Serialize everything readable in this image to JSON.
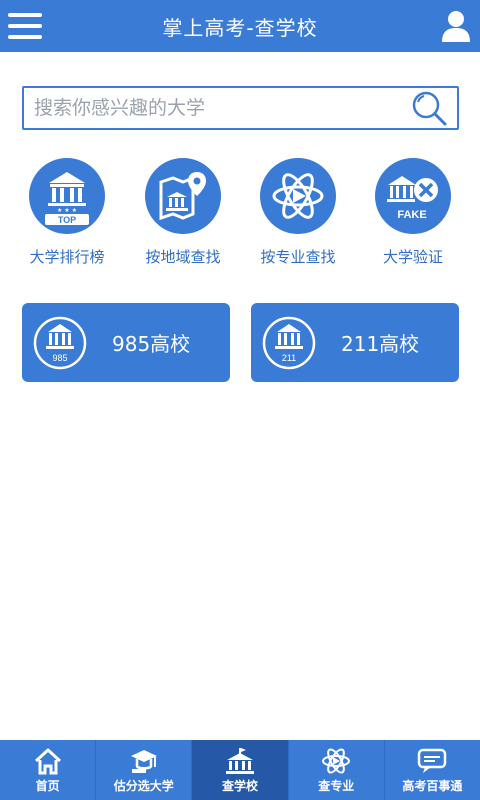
{
  "header": {
    "title": "掌上高考-查学校"
  },
  "search": {
    "placeholder": "搜索你感兴趣的大学"
  },
  "quick": [
    {
      "label": "大学排行榜",
      "icon": "ranking-top-icon",
      "badge": "TOP"
    },
    {
      "label": "按地域查找",
      "icon": "map-pin-icon"
    },
    {
      "label": "按专业查找",
      "icon": "atom-icon"
    },
    {
      "label": "大学验证",
      "icon": "fake-verify-icon",
      "badge": "FAKE"
    }
  ],
  "tiles": [
    {
      "label": "985高校",
      "badge": "985"
    },
    {
      "label": "211高校",
      "badge": "211"
    }
  ],
  "tabs": [
    {
      "label": "首页",
      "icon": "home-icon"
    },
    {
      "label": "估分选大学",
      "icon": "graduation-cap-icon"
    },
    {
      "label": "查学校",
      "icon": "school-building-icon",
      "active": true
    },
    {
      "label": "查专业",
      "icon": "atom-icon"
    },
    {
      "label": "高考百事通",
      "icon": "chat-bubble-icon"
    }
  ],
  "colors": {
    "primary": "#3a7bd5",
    "active_tab": "#2558a7",
    "label": "#2f6fc4"
  }
}
